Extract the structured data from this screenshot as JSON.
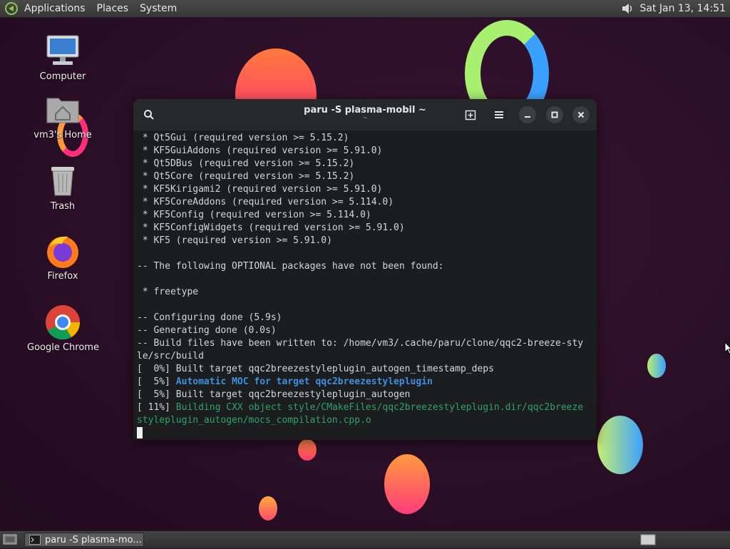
{
  "top_panel": {
    "menus": [
      "Applications",
      "Places",
      "System"
    ],
    "clock": "Sat Jan 13, 14:51"
  },
  "desktop_icons": [
    {
      "label": "Computer",
      "icon": "computer-icon"
    },
    {
      "label": "vm3's Home",
      "icon": "home-folder-icon"
    },
    {
      "label": "Trash",
      "icon": "trash-icon"
    },
    {
      "label": "Firefox",
      "icon": "firefox-icon"
    },
    {
      "label": "Google Chrome",
      "icon": "chrome-icon"
    }
  ],
  "terminal": {
    "title": "paru -S plasma-mobil ~",
    "subtitle": "~",
    "lines": [
      " * Qt5Gui (required version >= 5.15.2)",
      " * KF5GuiAddons (required version >= 5.91.0)",
      " * Qt5DBus (required version >= 5.15.2)",
      " * Qt5Core (required version >= 5.15.2)",
      " * KF5Kirigami2 (required version >= 5.91.0)",
      " * KF5CoreAddons (required version >= 5.114.0)",
      " * KF5Config (required version >= 5.114.0)",
      " * KF5ConfigWidgets (required version >= 5.91.0)",
      " * KF5 (required version >= 5.91.0)",
      "",
      "-- The following OPTIONAL packages have not been found:",
      "",
      " * freetype",
      "",
      "-- Configuring done (5.9s)",
      "-- Generating done (0.0s)",
      "-- Build files have been written to: /home/vm3/.cache/paru/clone/qqc2-breeze-sty",
      "le/src/build",
      "[  0%] Built target qqc2breezestyleplugin_autogen_timestamp_deps"
    ],
    "line_moc_prefix": "[  5%] ",
    "line_moc_text": "Automatic MOC for target qqc2breezestyleplugin",
    "line_autogen": "[  5%] Built target qqc2breezestyleplugin_autogen",
    "line_cxx_prefix": "[ 11%] ",
    "line_cxx_text": "Building CXX object style/CMakeFiles/qqc2breezestyleplugin.dir/qqc2breeze",
    "line_cxx_cont": "styleplugin_autogen/mocs_compilation.cpp.o"
  },
  "taskbar": {
    "task_label": "paru -S plasma-mo..."
  }
}
